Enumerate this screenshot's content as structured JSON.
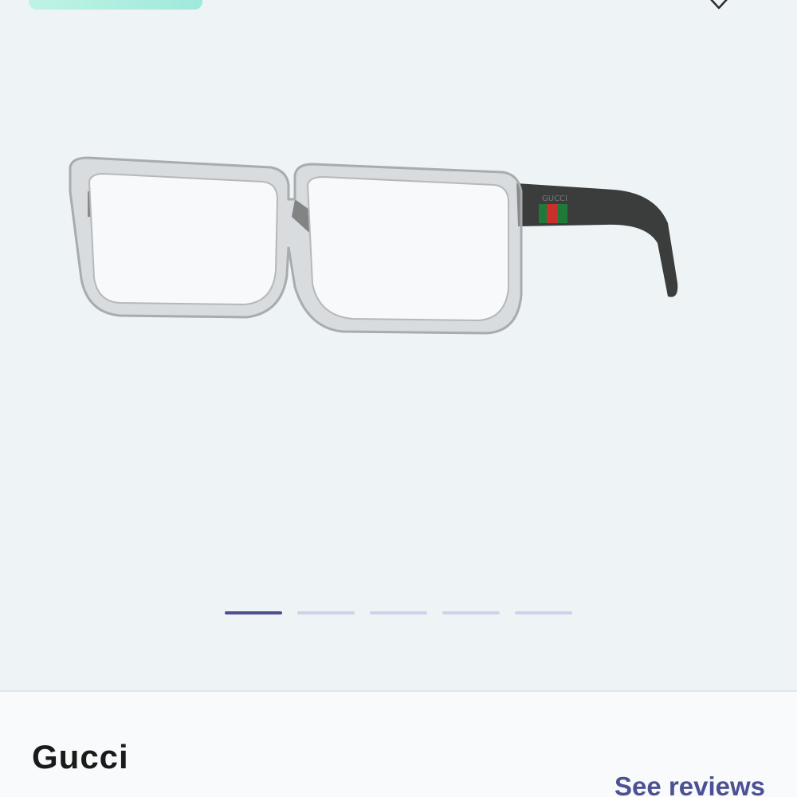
{
  "product": {
    "brand": "Gucci",
    "reviews_link": "See reviews",
    "image_icon": "eyeglasses-image"
  },
  "gallery": {
    "slide_count": 5,
    "active_index": 0
  },
  "colors": {
    "background": "#eef3f5",
    "accent": "#4c5193",
    "indicator_inactive": "#cfd2ea",
    "promo": "#a8ece0"
  },
  "icons": {
    "wishlist": "heart-outline-icon"
  }
}
